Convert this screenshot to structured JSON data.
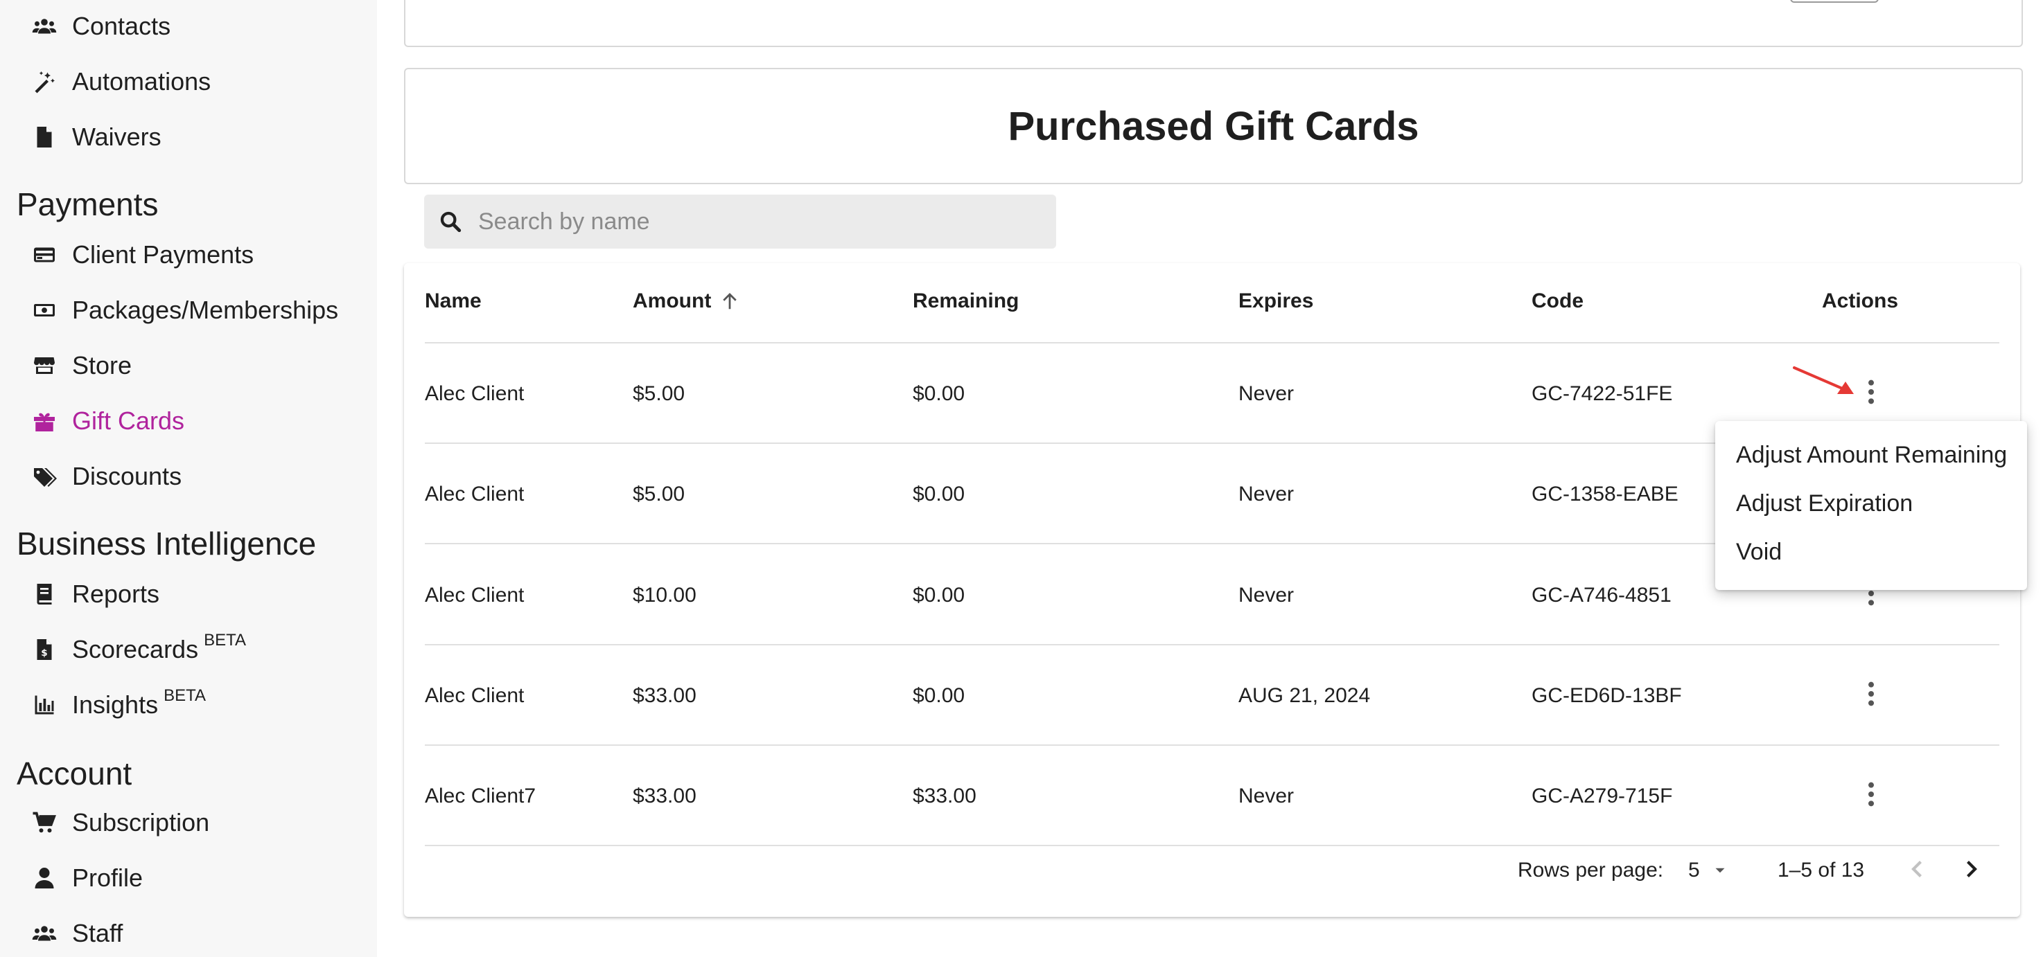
{
  "sidebar": {
    "items_top": [
      {
        "label": "Contacts",
        "icon": "contacts-icon"
      },
      {
        "label": "Automations",
        "icon": "magic-wand-icon"
      },
      {
        "label": "Waivers",
        "icon": "document-icon"
      }
    ],
    "payments": {
      "title": "Payments",
      "items": [
        {
          "label": "Client Payments",
          "icon": "credit-card-icon"
        },
        {
          "label": "Packages/Memberships",
          "icon": "money-icon"
        },
        {
          "label": "Store",
          "icon": "store-icon"
        },
        {
          "label": "Gift Cards",
          "icon": "gift-icon",
          "active": true
        },
        {
          "label": "Discounts",
          "icon": "tags-icon"
        }
      ]
    },
    "business_intelligence": {
      "title": "Business Intelligence",
      "items": [
        {
          "label": "Reports",
          "icon": "book-icon"
        },
        {
          "label": "Scorecards",
          "badge": "BETA",
          "icon": "invoice-icon"
        },
        {
          "label": "Insights",
          "badge": "BETA",
          "icon": "bar-chart-icon"
        }
      ]
    },
    "account": {
      "title": "Account",
      "items": [
        {
          "label": "Subscription",
          "icon": "cart-icon"
        },
        {
          "label": "Profile",
          "icon": "person-icon"
        },
        {
          "label": "Staff",
          "icon": "group-icon"
        }
      ]
    }
  },
  "page": {
    "title": "Purchased Gift Cards",
    "search_placeholder": "Search by name"
  },
  "table": {
    "columns": [
      "Name",
      "Amount",
      "Remaining",
      "Expires",
      "Code",
      "Actions"
    ],
    "sort_column": "Amount",
    "sort_direction": "ascending",
    "rows": [
      {
        "name": "Alec Client",
        "amount": "$5.00",
        "remaining": "$0.00",
        "expires": "Never",
        "code": "GC-7422-51FE"
      },
      {
        "name": "Alec Client",
        "amount": "$5.00",
        "remaining": "$0.00",
        "expires": "Never",
        "code": "GC-1358-EABE"
      },
      {
        "name": "Alec Client",
        "amount": "$10.00",
        "remaining": "$0.00",
        "expires": "Never",
        "code": "GC-A746-4851"
      },
      {
        "name": "Alec Client",
        "amount": "$33.00",
        "remaining": "$0.00",
        "expires": "AUG 21, 2024",
        "code": "GC-ED6D-13BF"
      },
      {
        "name": "Alec Client7",
        "amount": "$33.00",
        "remaining": "$33.00",
        "expires": "Never",
        "code": "GC-A279-715F"
      }
    ],
    "footer": {
      "rows_per_page_label": "Rows per page:",
      "rows_per_page_value": "5",
      "range": "1–5 of 13"
    }
  },
  "action_menu": {
    "open_for_row": 0,
    "items": [
      "Adjust Amount Remaining",
      "Adjust Expiration",
      "Void"
    ]
  },
  "colors": {
    "accent": "#b0239d",
    "annotation_arrow": "#e53935"
  }
}
